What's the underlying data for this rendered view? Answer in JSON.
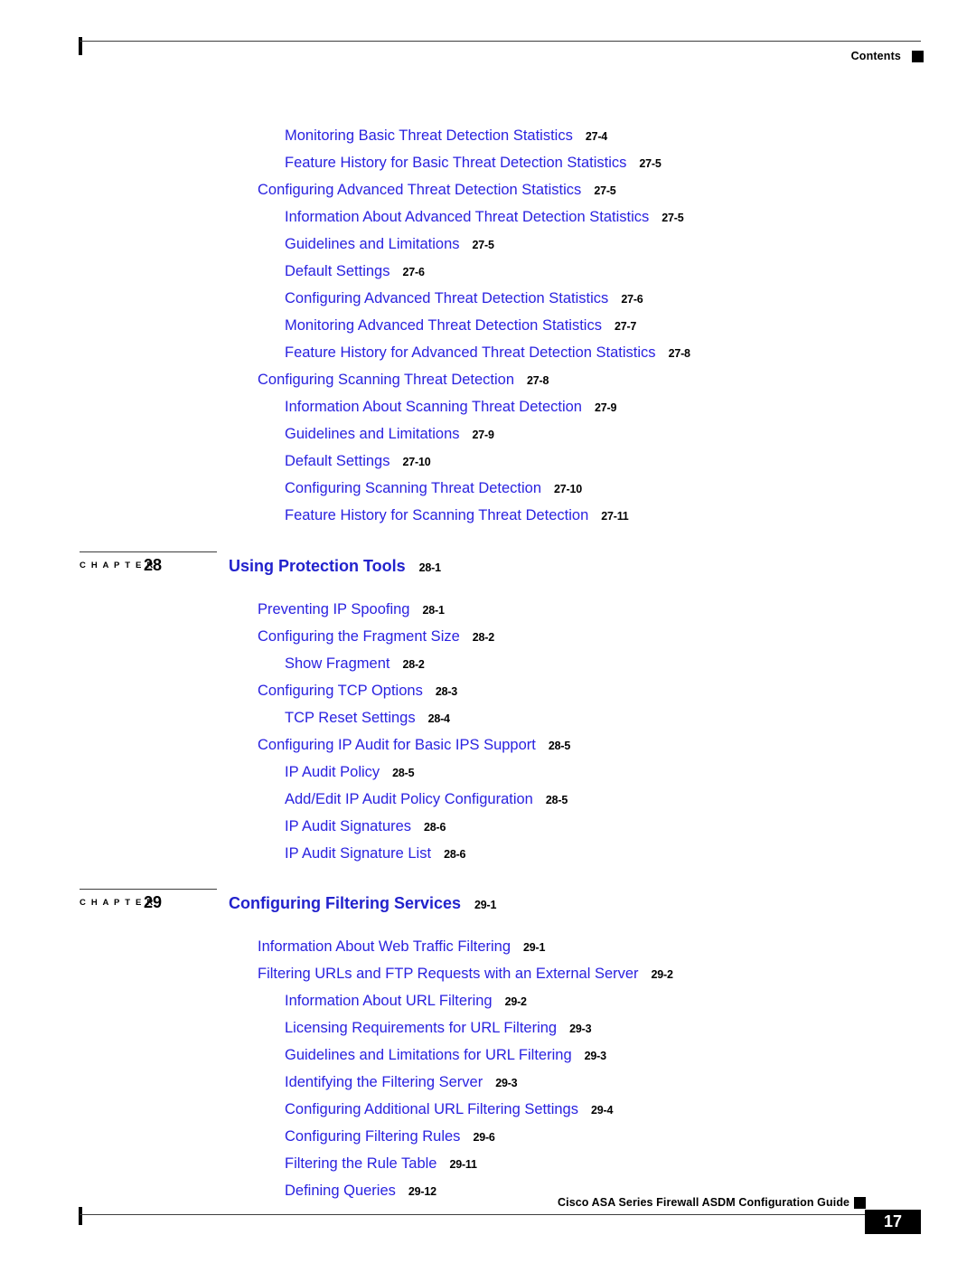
{
  "header": {
    "label": "Contents"
  },
  "footer": {
    "guide_title": "Cisco ASA Series Firewall ASDM Configuration Guide",
    "page_number": "17"
  },
  "chapter_tag_label": "C H A P T E R",
  "toc": {
    "top_entries": [
      {
        "level": 2,
        "title": "Monitoring Basic Threat Detection Statistics",
        "page": "27-4"
      },
      {
        "level": 2,
        "title": "Feature History for Basic Threat Detection Statistics",
        "page": "27-5"
      },
      {
        "level": 1,
        "title": "Configuring Advanced Threat Detection Statistics",
        "page": "27-5"
      },
      {
        "level": 2,
        "title": "Information About Advanced Threat Detection Statistics",
        "page": "27-5"
      },
      {
        "level": 2,
        "title": "Guidelines and Limitations",
        "page": "27-5"
      },
      {
        "level": 2,
        "title": "Default Settings",
        "page": "27-6"
      },
      {
        "level": 2,
        "title": "Configuring Advanced Threat Detection Statistics",
        "page": "27-6"
      },
      {
        "level": 2,
        "title": "Monitoring Advanced Threat Detection Statistics",
        "page": "27-7"
      },
      {
        "level": 2,
        "title": "Feature History for Advanced Threat Detection Statistics",
        "page": "27-8"
      },
      {
        "level": 1,
        "title": "Configuring Scanning Threat Detection",
        "page": "27-8"
      },
      {
        "level": 2,
        "title": "Information About Scanning Threat Detection",
        "page": "27-9"
      },
      {
        "level": 2,
        "title": "Guidelines and Limitations",
        "page": "27-9"
      },
      {
        "level": 2,
        "title": "Default Settings",
        "page": "27-10"
      },
      {
        "level": 2,
        "title": "Configuring Scanning Threat Detection",
        "page": "27-10"
      },
      {
        "level": 2,
        "title": "Feature History for Scanning Threat Detection",
        "page": "27-11"
      }
    ],
    "chapters": [
      {
        "number": "28",
        "title": "Using Protection Tools",
        "page": "28-1",
        "entries": [
          {
            "level": 1,
            "title": "Preventing IP Spoofing",
            "page": "28-1"
          },
          {
            "level": 1,
            "title": "Configuring the Fragment Size",
            "page": "28-2"
          },
          {
            "level": 2,
            "title": "Show Fragment",
            "page": "28-2"
          },
          {
            "level": 1,
            "title": "Configuring TCP Options",
            "page": "28-3"
          },
          {
            "level": 2,
            "title": "TCP Reset Settings",
            "page": "28-4"
          },
          {
            "level": 1,
            "title": "Configuring IP Audit for Basic IPS Support",
            "page": "28-5"
          },
          {
            "level": 2,
            "title": "IP Audit Policy",
            "page": "28-5"
          },
          {
            "level": 2,
            "title": "Add/Edit IP Audit Policy Configuration",
            "page": "28-5"
          },
          {
            "level": 2,
            "title": "IP Audit Signatures",
            "page": "28-6"
          },
          {
            "level": 2,
            "title": "IP Audit Signature List",
            "page": "28-6"
          }
        ]
      },
      {
        "number": "29",
        "title": "Configuring Filtering Services",
        "page": "29-1",
        "entries": [
          {
            "level": 1,
            "title": "Information About Web Traffic Filtering",
            "page": "29-1"
          },
          {
            "level": 1,
            "title": "Filtering URLs and FTP Requests with an External Server",
            "page": "29-2"
          },
          {
            "level": 2,
            "title": "Information About URL Filtering",
            "page": "29-2"
          },
          {
            "level": 2,
            "title": "Licensing Requirements for URL Filtering",
            "page": "29-3"
          },
          {
            "level": 2,
            "title": "Guidelines and Limitations for URL Filtering",
            "page": "29-3"
          },
          {
            "level": 2,
            "title": "Identifying the Filtering Server",
            "page": "29-3"
          },
          {
            "level": 2,
            "title": "Configuring Additional URL Filtering Settings",
            "page": "29-4"
          },
          {
            "level": 2,
            "title": "Configuring Filtering Rules",
            "page": "29-6"
          },
          {
            "level": 2,
            "title": "Filtering the Rule Table",
            "page": "29-11"
          },
          {
            "level": 2,
            "title": "Defining Queries",
            "page": "29-12"
          }
        ]
      }
    ]
  }
}
